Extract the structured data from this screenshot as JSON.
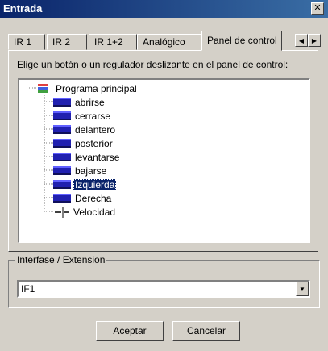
{
  "window": {
    "title": "Entrada",
    "close_glyph": "✕"
  },
  "tabs": [
    {
      "label": "IR 1"
    },
    {
      "label": "IR 2"
    },
    {
      "label": "IR 1+2"
    },
    {
      "label": "Analógico"
    },
    {
      "label": "Panel de control",
      "active": true
    }
  ],
  "tab_scroll": {
    "left_glyph": "◀",
    "right_glyph": "▶"
  },
  "panel": {
    "instruction": "Elige un botón o un regulador deslizante en el panel de control:"
  },
  "tree": {
    "root": {
      "label": "Programa principal",
      "icon": "program-icon"
    },
    "items": [
      {
        "label": "abrirse",
        "icon": "button-icon"
      },
      {
        "label": "cerrarse",
        "icon": "button-icon"
      },
      {
        "label": "delantero",
        "icon": "button-icon"
      },
      {
        "label": "posterior",
        "icon": "button-icon"
      },
      {
        "label": "levantarse",
        "icon": "button-icon"
      },
      {
        "label": "bajarse",
        "icon": "button-icon"
      },
      {
        "label": "Izquierda",
        "icon": "button-icon",
        "selected": true
      },
      {
        "label": "Derecha",
        "icon": "button-icon"
      },
      {
        "label": "Velocidad",
        "icon": "slider-icon"
      }
    ]
  },
  "interface": {
    "legend": "Interfase / Extension",
    "selected_value": "IF1",
    "dropdown_glyph": "▼"
  },
  "buttons": {
    "ok": "Aceptar",
    "cancel": "Cancelar"
  },
  "colors": {
    "title_bar": "#0a246a",
    "selection": "#0a246a",
    "button_icon": "#2020b0",
    "dialog_bg": "#d4d0c8"
  }
}
